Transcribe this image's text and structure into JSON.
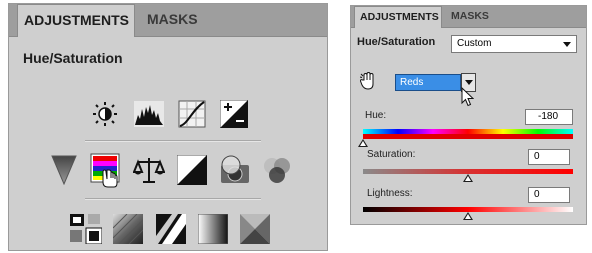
{
  "left_panel": {
    "tabs": [
      {
        "label": "ADJUSTMENTS"
      },
      {
        "label": "MASKS"
      }
    ],
    "title": "Hue/Saturation",
    "icon_rows": [
      [
        "brightness-contrast-icon",
        "levels-icon",
        "curves-icon",
        "exposure-icon"
      ],
      [
        "vibrance-icon",
        "hue-saturation-icon",
        "color-balance-icon",
        "black-white-icon",
        "photo-filter-icon",
        "channel-mixer-icon"
      ],
      [
        "invert-icon",
        "posterize-icon",
        "threshold-icon",
        "gradient-map-icon",
        "selective-color-icon"
      ]
    ]
  },
  "right_panel": {
    "tabs": [
      {
        "label": "ADJUSTMENTS"
      },
      {
        "label": "MASKS"
      }
    ],
    "title": "Hue/Saturation",
    "preset": {
      "value": "Custom"
    },
    "channel": {
      "value": "Reds"
    },
    "hue": {
      "label": "Hue:",
      "value": "-180",
      "position": 0
    },
    "saturation": {
      "label": "Saturation:",
      "value": "0",
      "position": 0.5
    },
    "lightness": {
      "label": "Lightness:",
      "value": "0",
      "position": 0.5
    }
  },
  "colors": {
    "panel": "#cfcfcf",
    "tabbar": "#9e9e9e",
    "channel_select": "#3a8ee6"
  }
}
